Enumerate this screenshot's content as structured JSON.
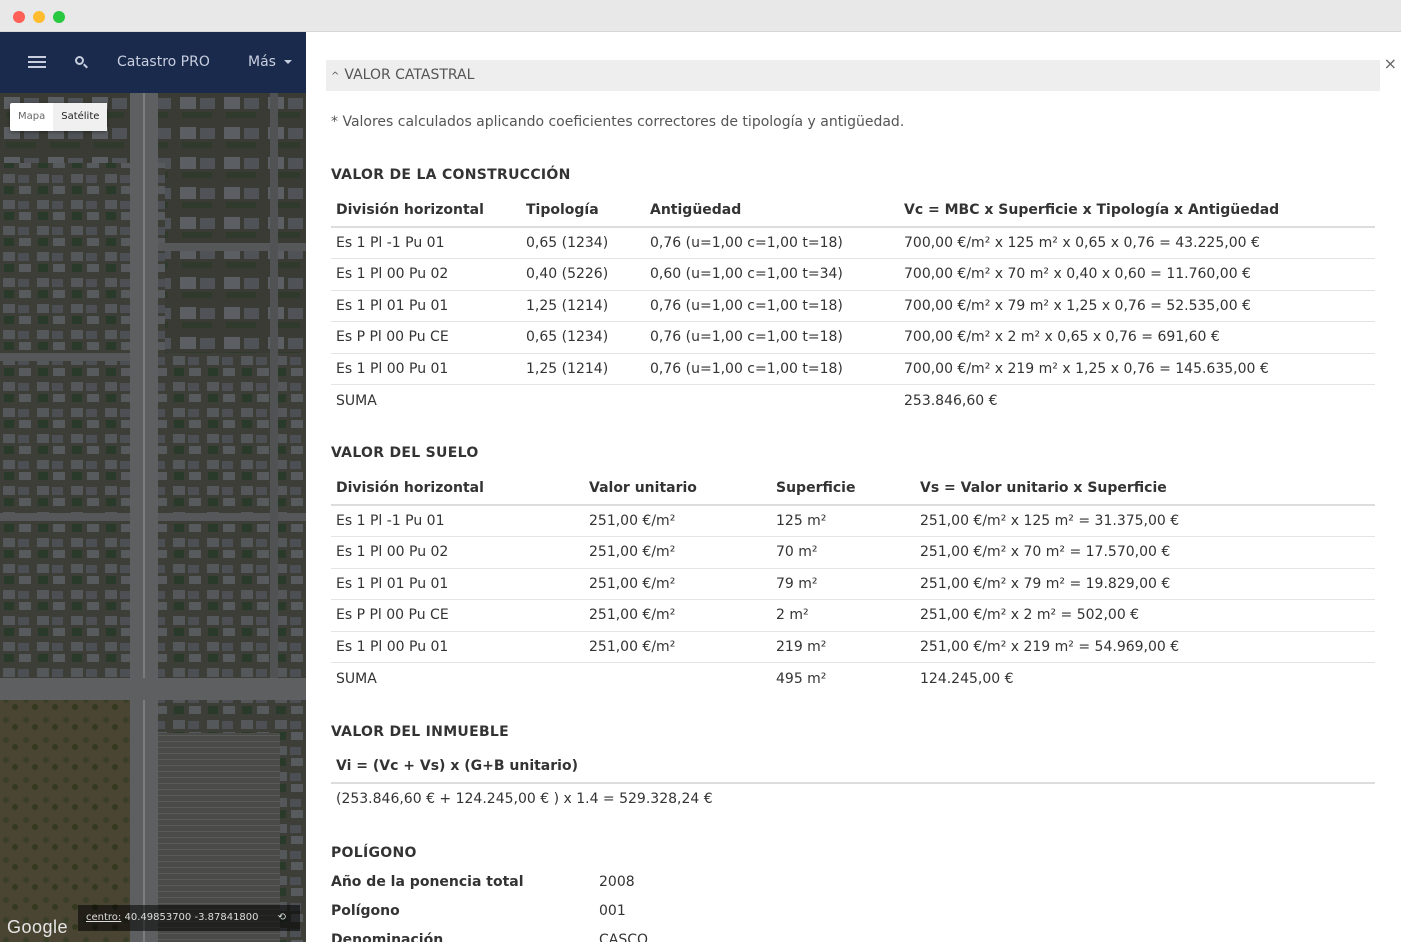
{
  "map": {
    "brand": "Catastro PRO",
    "more_menu": "Más",
    "map_types": [
      "Mapa",
      "Satélite"
    ],
    "center_label": "centro:",
    "center_value": "40.49853700 -3.87841800",
    "google": "Google"
  },
  "panel": {
    "close": "×",
    "section_title": "VALOR CATASTRAL",
    "note": "* Valores calculados aplicando coeficientes correctores de tipología y antigüedad."
  },
  "construccion": {
    "title": "VALOR DE LA CONSTRUCCIÓN",
    "headers": [
      "División horizontal",
      "Tipología",
      "Antigüedad",
      "Vc = MBC x Superficie x Tipología x Antigüedad"
    ],
    "rows": [
      [
        "Es 1 Pl -1 Pu 01",
        "0,65 (1234)",
        "0,76 (u=1,00 c=1,00 t=18)",
        "700,00 €/m² x 125 m² x 0,65 x 0,76 = 43.225,00 €"
      ],
      [
        "Es 1 Pl 00 Pu 02",
        "0,40 (5226)",
        "0,60 (u=1,00 c=1,00 t=34)",
        "700,00 €/m² x 70 m² x 0,40 x 0,60 = 11.760,00 €"
      ],
      [
        "Es 1 Pl 01 Pu 01",
        "1,25 (1214)",
        "0,76 (u=1,00 c=1,00 t=18)",
        "700,00 €/m² x 79 m² x 1,25 x 0,76 = 52.535,00 €"
      ],
      [
        "Es P Pl 00 Pu CE",
        "0,65 (1234)",
        "0,76 (u=1,00 c=1,00 t=18)",
        "700,00 €/m² x 2 m² x 0,65 x 0,76 = 691,60 €"
      ],
      [
        "Es 1 Pl 00 Pu 01",
        "1,25 (1214)",
        "0,76 (u=1,00 c=1,00 t=18)",
        "700,00 €/m² x 219 m² x 1,25 x 0,76 = 145.635,00 €"
      ],
      [
        "SUMA",
        "",
        "",
        "253.846,60 €"
      ]
    ]
  },
  "suelo": {
    "title": "VALOR DEL SUELO",
    "headers": [
      "División horizontal",
      "Valor unitario",
      "Superficie",
      "Vs = Valor unitario x Superficie"
    ],
    "rows": [
      [
        "Es 1 Pl -1 Pu 01",
        "251,00 €/m²",
        "125 m²",
        "251,00 €/m² x 125 m² = 31.375,00 €"
      ],
      [
        "Es 1 Pl 00 Pu 02",
        "251,00 €/m²",
        "70 m²",
        "251,00 €/m² x 70 m² = 17.570,00 €"
      ],
      [
        "Es 1 Pl 01 Pu 01",
        "251,00 €/m²",
        "79 m²",
        "251,00 €/m² x 79 m² = 19.829,00 €"
      ],
      [
        "Es P Pl 00 Pu CE",
        "251,00 €/m²",
        "2 m²",
        "251,00 €/m² x 2 m² = 502,00 €"
      ],
      [
        "Es 1 Pl 00 Pu 01",
        "251,00 €/m²",
        "219 m²",
        "251,00 €/m² x 219 m² = 54.969,00 €"
      ],
      [
        "SUMA",
        "",
        "495 m²",
        "124.245,00 €"
      ]
    ]
  },
  "inmueble": {
    "title": "VALOR DEL INMUEBLE",
    "header": "Vi = (Vc + Vs) x (G+B unitario)",
    "value": "(253.846,60 € + 124.245,00 € ) x 1.4 = 529.328,24 €"
  },
  "poligono": {
    "title": "POLÍGONO",
    "rows": [
      [
        "Año de la ponencia total",
        "2008"
      ],
      [
        "Polígono",
        "001"
      ],
      [
        "Denominación",
        "CASCO ANTIGUO"
      ]
    ]
  }
}
